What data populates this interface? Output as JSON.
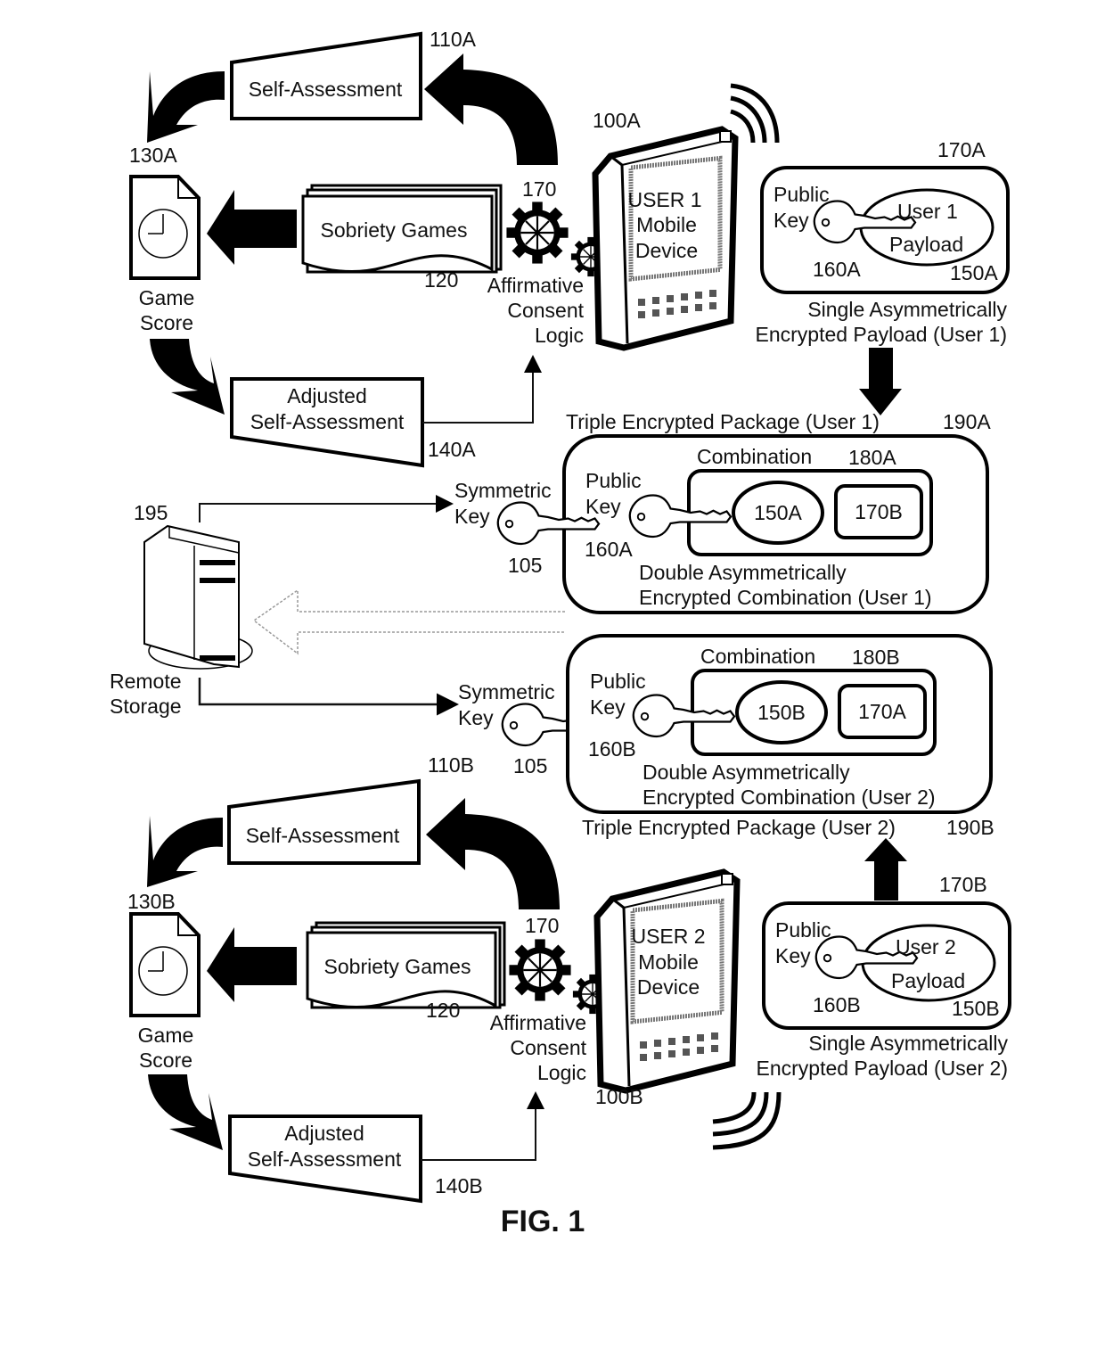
{
  "figure": {
    "title": "FIG. 1",
    "remote_storage": {
      "ref": "195",
      "label_line1": "Remote",
      "label_line2": "Storage"
    },
    "symmetric_key": {
      "ref": "105",
      "label_line1": "Symmetric",
      "label_line2": "Key"
    },
    "users": [
      {
        "device": {
          "ref": "100A",
          "line1": "USER 1",
          "line2": "Mobile",
          "line3": "Device"
        },
        "self_assessment": {
          "ref": "110A",
          "label": "Self-Assessment"
        },
        "sobriety_games": {
          "ref": "120",
          "label": "Sobriety Games"
        },
        "game_score": {
          "ref": "130A",
          "line1": "Game",
          "line2": "Score"
        },
        "adjusted": {
          "ref": "140A",
          "line1": "Adjusted",
          "line2": "Self-Assessment"
        },
        "consent": {
          "ref": "170",
          "line1": "Affirmative",
          "line2": "Consent",
          "line3": "Logic"
        },
        "single_payload": {
          "ref": "170A",
          "key_line1": "Public",
          "key_line2": "Key",
          "key_ref": "160A",
          "payload_line1": "User 1",
          "payload_line2": "Payload",
          "payload_ref": "150A",
          "caption1": "Single Asymmetrically",
          "caption2": "Encrypted Payload (User 1)"
        },
        "triple_package": {
          "label": "Triple Encrypted Package (User 1)",
          "ref": "190A",
          "combination_label": "Combination",
          "combination_ref": "180A",
          "key_line1": "Public",
          "key_line2": "Key",
          "key_ref": "160A",
          "item1": "150A",
          "item2": "170B",
          "caption1": "Double Asymmetrically",
          "caption2": "Encrypted Combination (User 1)"
        }
      },
      {
        "device": {
          "ref": "100B",
          "line1": "USER 2",
          "line2": "Mobile",
          "line3": "Device"
        },
        "self_assessment": {
          "ref": "110B",
          "label": "Self-Assessment"
        },
        "sobriety_games": {
          "ref": "120",
          "label": "Sobriety Games"
        },
        "game_score": {
          "ref": "130B",
          "line1": "Game",
          "line2": "Score"
        },
        "adjusted": {
          "ref": "140B",
          "line1": "Adjusted",
          "line2": "Self-Assessment"
        },
        "consent": {
          "ref": "170",
          "line1": "Affirmative",
          "line2": "Consent",
          "line3": "Logic"
        },
        "single_payload": {
          "ref": "170B",
          "key_line1": "Public",
          "key_line2": "Key",
          "key_ref": "160B",
          "payload_line1": "User 2",
          "payload_line2": "Payload",
          "payload_ref": "150B",
          "caption1": "Single Asymmetrically",
          "caption2": "Encrypted Payload (User 2)"
        },
        "triple_package": {
          "label": "Triple Encrypted Package (User 2)",
          "ref": "190B",
          "combination_label": "Combination",
          "combination_ref": "180B",
          "key_line1": "Public",
          "key_line2": "Key",
          "key_ref": "160B",
          "item1": "150B",
          "item2": "170A",
          "caption1": "Double Asymmetrically",
          "caption2": "Encrypted Combination (User 2)"
        }
      }
    ]
  }
}
